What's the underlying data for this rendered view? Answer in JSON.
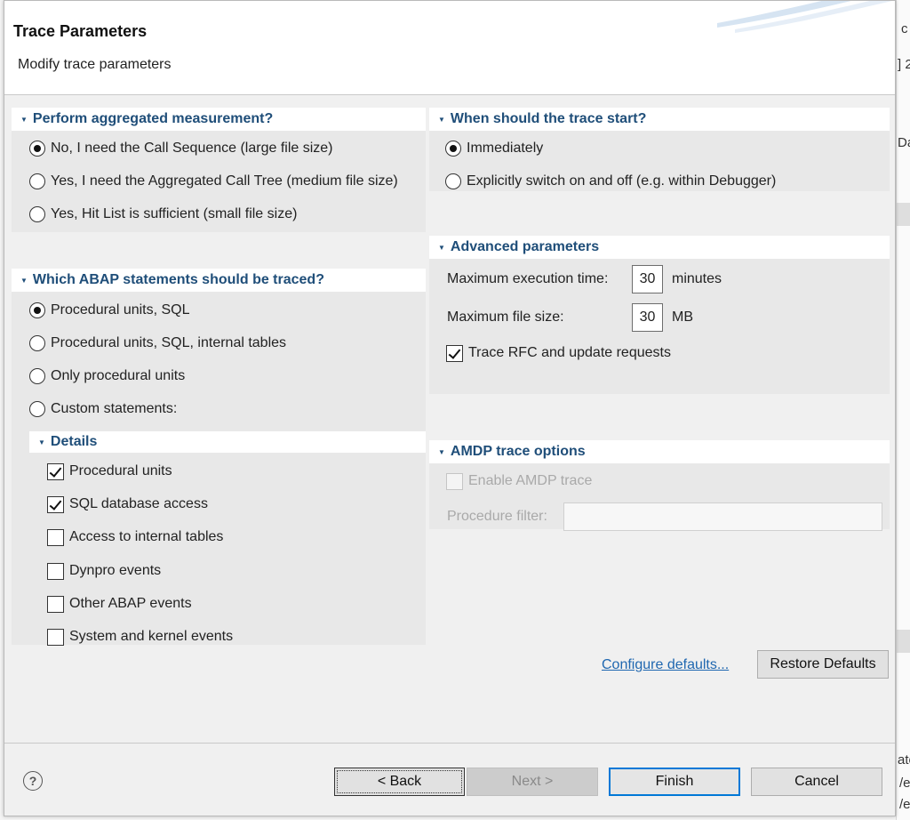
{
  "dialog": {
    "title": "Trace Parameters",
    "subtitle": "Modify trace parameters"
  },
  "background_fragments": [
    "c",
    "] 2",
    "Da",
    "ate",
    "/e",
    "/e"
  ],
  "aggregated": {
    "heading": "Perform aggregated measurement?",
    "options": [
      {
        "label": "No, I need the Call Sequence (large file size)",
        "selected": true
      },
      {
        "label": "Yes, I need the Aggregated Call Tree (medium file size)",
        "selected": false
      },
      {
        "label": "Yes, Hit List is sufficient (small file size)",
        "selected": false
      }
    ]
  },
  "trace_start": {
    "heading": "When should the trace start?",
    "options": [
      {
        "label": "Immediately",
        "selected": true
      },
      {
        "label": "Explicitly switch on and off (e.g. within Debugger)",
        "selected": false
      }
    ]
  },
  "advanced": {
    "heading": "Advanced parameters",
    "max_exec_label": "Maximum execution time:",
    "max_exec_value": "30",
    "max_exec_unit": "minutes",
    "max_file_label": "Maximum file size:",
    "max_file_value": "30",
    "max_file_unit": "MB",
    "rfc_label": "Trace RFC and update requests",
    "rfc_checked": true
  },
  "statements": {
    "heading": "Which ABAP statements should be traced?",
    "options": [
      {
        "label": "Procedural units, SQL",
        "selected": true
      },
      {
        "label": "Procedural units, SQL, internal tables",
        "selected": false
      },
      {
        "label": "Only procedural units",
        "selected": false
      },
      {
        "label": "Custom statements:",
        "selected": false
      }
    ]
  },
  "details": {
    "heading": "Details",
    "items": [
      {
        "label": "Procedural units",
        "checked": true
      },
      {
        "label": "SQL database access",
        "checked": true
      },
      {
        "label": "Access to internal tables",
        "checked": false
      },
      {
        "label": "Dynpro events",
        "checked": false
      },
      {
        "label": "Other ABAP events",
        "checked": false
      },
      {
        "label": "System and kernel events",
        "checked": false
      }
    ]
  },
  "amdp": {
    "heading": "AMDP trace options",
    "enable_label": "Enable AMDP trace",
    "enable_checked": false,
    "filter_label": "Procedure filter:",
    "filter_value": ""
  },
  "actions": {
    "configure_link": "Configure defaults...",
    "restore_button": "Restore Defaults"
  },
  "footer": {
    "help_icon": "?",
    "back_button": "< Back",
    "next_button": "Next >",
    "finish_button": "Finish",
    "cancel_button": "Cancel"
  }
}
